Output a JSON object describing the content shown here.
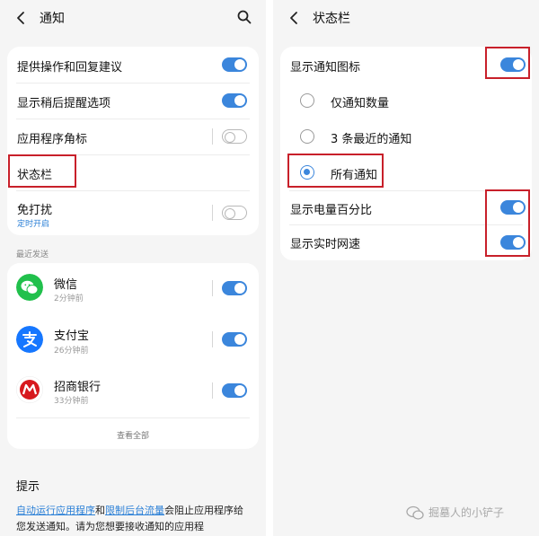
{
  "left_screen": {
    "title": "通知",
    "settings": [
      {
        "label": "提供操作和回复建议",
        "on": true
      },
      {
        "label": "显示稍后提醒选项",
        "on": true
      },
      {
        "label": "应用程序角标",
        "on": false
      },
      {
        "label": "状态栏"
      },
      {
        "label": "免打扰",
        "sub": "定时开启",
        "on": false
      }
    ],
    "recent_section": "最近发送",
    "apps": [
      {
        "name": "微信",
        "time": "2分钟前",
        "on": true,
        "icon": "wechat-icon",
        "color": "#21c04c"
      },
      {
        "name": "支付宝",
        "time": "26分钟前",
        "on": true,
        "icon": "alipay-icon",
        "color": "#1677ff"
      },
      {
        "name": "招商银行",
        "time": "33分钟前",
        "on": true,
        "icon": "cmb-icon",
        "color": "#d7191e"
      }
    ],
    "view_all": "查看全部",
    "tips": {
      "title": "提示",
      "link1": "自动运行应用程序",
      "and": "和",
      "link2": "限制后台流量",
      "text": "会阻止应用程序给您发送通知。请为您想要接收通知的应用程"
    }
  },
  "right_screen": {
    "title": "状态栏",
    "show_icons": {
      "label": "显示通知图标",
      "on": true
    },
    "radio_options": [
      {
        "label": "仅通知数量",
        "checked": false
      },
      {
        "label": "3 条最近的通知",
        "checked": false
      },
      {
        "label": "所有通知",
        "checked": true
      }
    ],
    "battery": {
      "label": "显示电量百分比",
      "on": true
    },
    "speed": {
      "label": "显示实时网速",
      "on": true
    }
  },
  "watermark": "掘墓人的小铲子",
  "colors": {
    "accent": "#3b86dc",
    "highlight": "#c8202a",
    "link": "#2a7fd6"
  }
}
